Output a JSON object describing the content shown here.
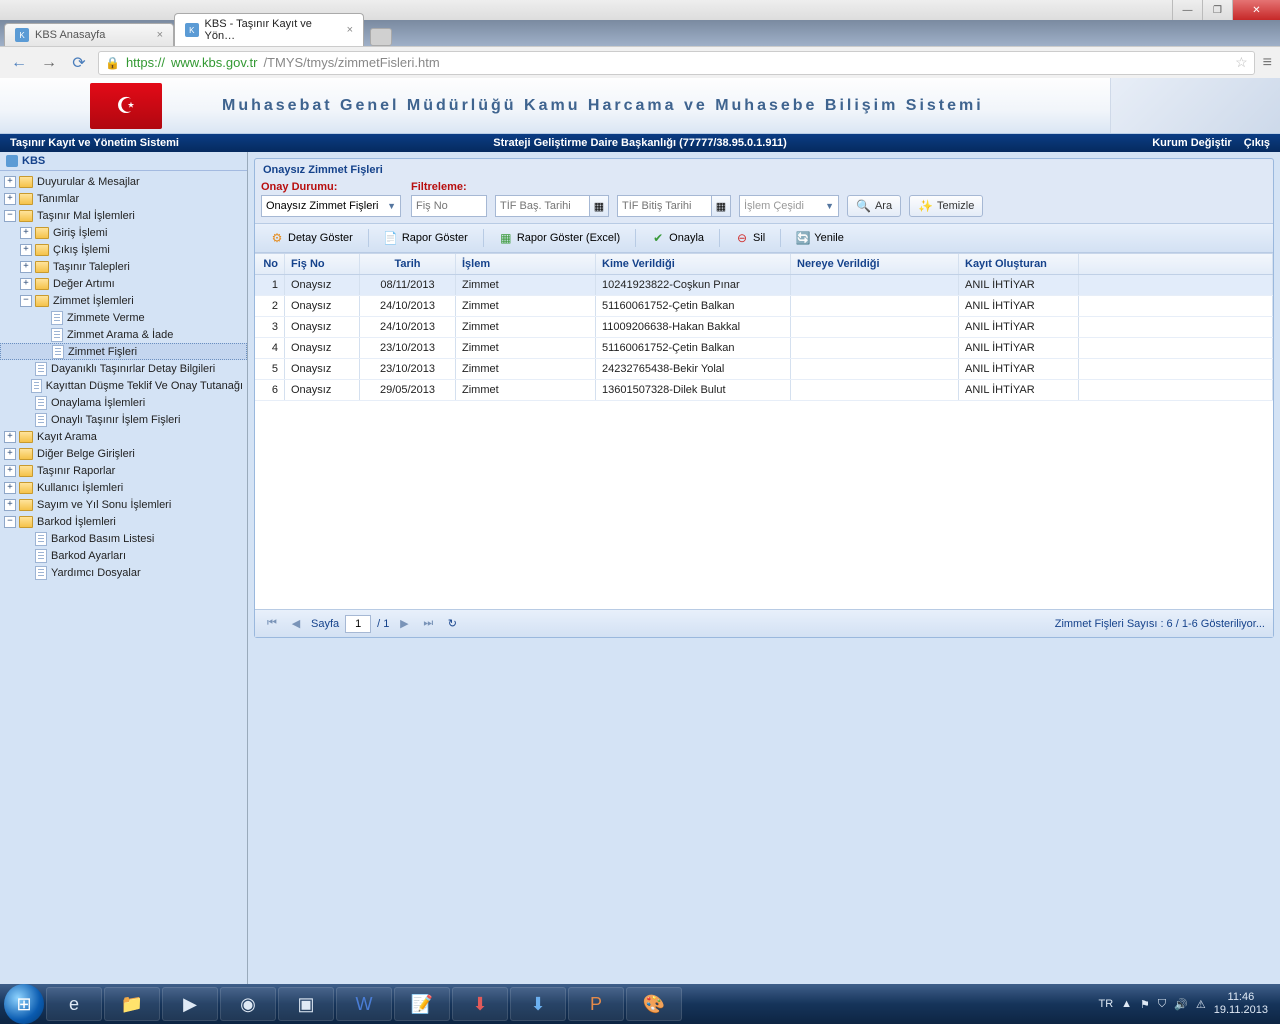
{
  "window": {
    "minimize": "—",
    "maximize": "❐",
    "close": "✕"
  },
  "browserTabs": [
    {
      "title": "KBS Anasayfa",
      "active": false
    },
    {
      "title": "KBS - Taşınır Kayıt ve Yön…",
      "active": true
    }
  ],
  "url": {
    "scheme": "https://",
    "host": "www.kbs.gov.tr",
    "path": "/TMYS/tmys/zimmetFisleri.htm"
  },
  "banner": {
    "title": "Muhasebat Genel Müdürlüğü Kamu Harcama ve Muhasebe Bilişim Sistemi"
  },
  "appbar": {
    "left": "Taşınır Kayıt ve Yönetim Sistemi",
    "center": "Strateji Geliştirme Daire Başkanlığı (77777/38.95.0.1.911)",
    "rightA": "Kurum Değiştir",
    "rightB": "Çıkış"
  },
  "sidebar": {
    "root": "KBS",
    "items": {
      "duyurular": "Duyurular & Mesajlar",
      "tanimlar": "Tanımlar",
      "tasinirMal": "Taşınır Mal İşlemleri",
      "giris": "Giriş İşlemi",
      "cikis": "Çıkış İşlemi",
      "talep": "Taşınır Talepleri",
      "deger": "Değer Artımı",
      "zimmet": "Zimmet İşlemleri",
      "zimmeteVerme": "Zimmete Verme",
      "zimmetArama": "Zimmet Arama & İade",
      "zimmetFisleri": "Zimmet Fişleri",
      "dayanikli": "Dayanıklı Taşınırlar Detay Bilgileri",
      "kayittanDusme": "Kayıttan Düşme Teklif Ve Onay Tutanağı",
      "onaylama": "Onaylama İşlemleri",
      "onayliFis": "Onaylı Taşınır İşlem Fişleri",
      "kayitArama": "Kayıt Arama",
      "digerBelge": "Diğer Belge Girişleri",
      "rapor": "Taşınır Raporlar",
      "kullanici": "Kullanıcı İşlemleri",
      "sayim": "Sayım ve Yıl Sonu İşlemleri",
      "barkod": "Barkod İşlemleri",
      "barkodBasim": "Barkod Basım Listesi",
      "barkodAyar": "Barkod Ayarları",
      "yardimci": "Yardımcı Dosyalar"
    }
  },
  "panel": {
    "title": "Onaysız Zimmet Fişleri",
    "onayLabel": "Onay Durumu:",
    "filtreLabel": "Filtreleme:",
    "onayCombo": "Onaysız Zimmet Fişleri",
    "fisNoPh": "Fiş No",
    "tifBasPh": "TİF Baş. Tarihi",
    "tifBitPh": "TİF Bitiş Tarihi",
    "islemCesidi": "İşlem Çeşidi",
    "ara": "Ara",
    "temizle": "Temizle"
  },
  "toolbar": {
    "detay": "Detay Göster",
    "rapor": "Rapor Göster",
    "raporExcel": "Rapor Göster (Excel)",
    "onayla": "Onayla",
    "sil": "Sil",
    "yenile": "Yenile"
  },
  "grid": {
    "cols": {
      "no": "No",
      "fis": "Fiş No",
      "tarih": "Tarih",
      "islem": "İşlem",
      "kime": "Kime Verildiği",
      "nereye": "Nereye Verildiği",
      "kayit": "Kayıt Oluşturan"
    },
    "rows": [
      {
        "no": "1",
        "fis": "Onaysız",
        "tarih": "08/11/2013",
        "islem": "Zimmet",
        "kime": "10241923822-Coşkun Pınar",
        "nereye": "",
        "kayit": "ANIL İHTİYAR"
      },
      {
        "no": "2",
        "fis": "Onaysız",
        "tarih": "24/10/2013",
        "islem": "Zimmet",
        "kime": "51160061752-Çetin Balkan",
        "nereye": "",
        "kayit": "ANIL İHTİYAR"
      },
      {
        "no": "3",
        "fis": "Onaysız",
        "tarih": "24/10/2013",
        "islem": "Zimmet",
        "kime": "11009206638-Hakan Bakkal",
        "nereye": "",
        "kayit": "ANIL İHTİYAR"
      },
      {
        "no": "4",
        "fis": "Onaysız",
        "tarih": "23/10/2013",
        "islem": "Zimmet",
        "kime": "51160061752-Çetin Balkan",
        "nereye": "",
        "kayit": "ANIL İHTİYAR"
      },
      {
        "no": "5",
        "fis": "Onaysız",
        "tarih": "23/10/2013",
        "islem": "Zimmet",
        "kime": "24232765438-Bekir Yolal",
        "nereye": "",
        "kayit": "ANIL İHTİYAR"
      },
      {
        "no": "6",
        "fis": "Onaysız",
        "tarih": "29/05/2013",
        "islem": "Zimmet",
        "kime": "13601507328-Dilek Bulut",
        "nereye": "",
        "kayit": "ANIL İHTİYAR"
      }
    ]
  },
  "pager": {
    "sayfa": "Sayfa",
    "page": "1",
    "of": "/ 1",
    "status": "Zimmet Fişleri Sayısı : 6 / 1-6 Gösteriliyor..."
  },
  "tray": {
    "lang": "TR",
    "time": "11:46",
    "date": "19.11.2013"
  }
}
